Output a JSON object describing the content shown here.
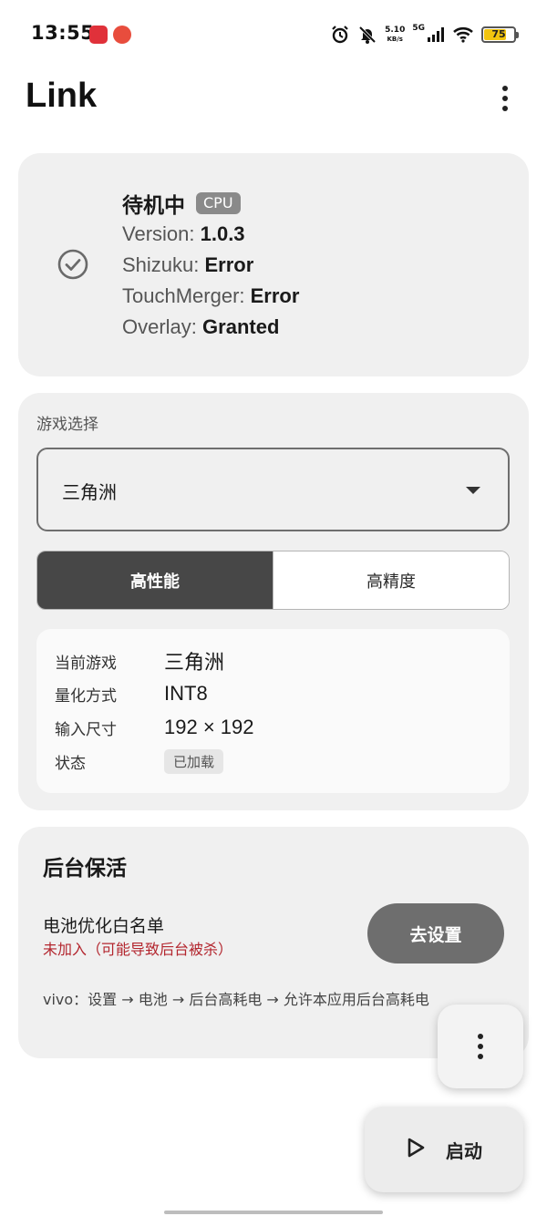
{
  "status_bar": {
    "time": "13:55",
    "net_speed_value": "5.10",
    "net_speed_unit": "KB/s",
    "network_type": "5G",
    "battery": "75",
    "battery_level": 75,
    "icons": [
      "app-icon",
      "app-icon",
      "alarm-icon",
      "mute-icon",
      "signal-icon",
      "wifi-icon",
      "battery-icon"
    ]
  },
  "app_bar": {
    "title": "Link",
    "menu_icon": "more-vert-icon"
  },
  "status_card": {
    "icon": "check-circle-icon",
    "title": "待机中",
    "badge": "CPU",
    "lines": [
      {
        "label": "Version: ",
        "value": "1.0.3"
      },
      {
        "label": "Shizuku: ",
        "value": "Error"
      },
      {
        "label": "TouchMerger: ",
        "value": "Error"
      },
      {
        "label": "Overlay: ",
        "value": "Granted"
      }
    ]
  },
  "game_card": {
    "section_label": "游戏选择",
    "selected_game": "三角洲",
    "dropdown_icon": "caret-down-icon",
    "modes": [
      {
        "label": "高性能",
        "active": true
      },
      {
        "label": "高精度",
        "active": false
      }
    ],
    "info": [
      {
        "key": "当前游戏",
        "value": "三角洲"
      },
      {
        "key": "量化方式",
        "value": "INT8"
      },
      {
        "key": "输入尺寸",
        "value": "192 × 192"
      },
      {
        "key": "状态",
        "value": "已加载"
      }
    ]
  },
  "keep_alive_card": {
    "title": "后台保活",
    "battery_opt_title": "电池优化白名单",
    "battery_opt_status": "未加入（可能导致后台被杀）",
    "button_label": "去设置",
    "hint": "vivo：设置 → 电池 → 后台高耗电 → 允许本应用后台高耗电"
  },
  "fab": {
    "more_icon": "more-vert-icon",
    "start_icon": "play-icon",
    "start_label": "启动"
  },
  "colors": {
    "accent_dark": "#474747",
    "card_bg": "#f0f0f0",
    "warning_red": "#b3262e",
    "button_gray": "#6e6e6e"
  }
}
